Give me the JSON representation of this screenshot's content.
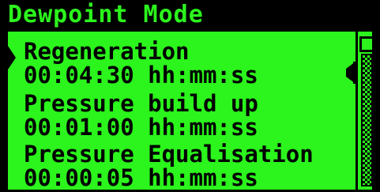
{
  "title": "Dewpoint Mode",
  "colors": {
    "lcd_green": "#2BF51C",
    "lcd_black": "#000000"
  },
  "menu": {
    "items": [
      {
        "label": "Regeneration",
        "value": "00:04:30 hh:mm:ss"
      },
      {
        "label": "Pressure build up",
        "value": "00:01:00 hh:mm:ss"
      },
      {
        "label": "Pressure Equalisation",
        "value": "00:00:05 hh:mm:ss"
      }
    ],
    "selected_index": 0
  },
  "scrollbar": {
    "position_fraction": 0.0
  },
  "icons": {
    "left_marker": "selection-arrow-right-icon",
    "right_marker": "selection-arrow-left-icon"
  }
}
